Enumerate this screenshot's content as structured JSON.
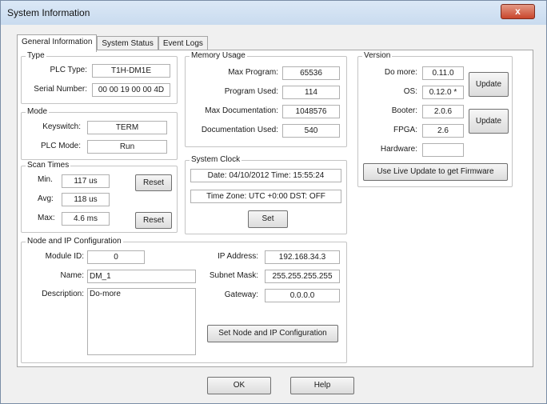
{
  "window": {
    "title": "System Information",
    "close_glyph": "x"
  },
  "tabs": [
    {
      "label": "General Information",
      "active": true
    },
    {
      "label": "System Status",
      "active": false
    },
    {
      "label": "Event Logs",
      "active": false
    }
  ],
  "type_group": {
    "title": "Type",
    "plc_type_label": "PLC Type:",
    "plc_type_value": "T1H-DM1E",
    "serial_label": "Serial Number:",
    "serial_value": "00 00 19 00 00 4D"
  },
  "mode_group": {
    "title": "Mode",
    "keyswitch_label": "Keyswitch:",
    "keyswitch_value": "TERM",
    "plc_mode_label": "PLC Mode:",
    "plc_mode_value": "Run"
  },
  "scan_group": {
    "title": "Scan Times",
    "min_label": "Min.",
    "min_value": "117 us",
    "avg_label": "Avg:",
    "avg_value": "118 us",
    "max_label": "Max:",
    "max_value": "4.6 ms",
    "reset_label": "Reset"
  },
  "memory_group": {
    "title": "Memory Usage",
    "max_program_label": "Max Program:",
    "max_program_value": "65536",
    "program_used_label": "Program Used:",
    "program_used_value": "114",
    "max_doc_label": "Max Documentation:",
    "max_doc_value": "1048576",
    "doc_used_label": "Documentation Used:",
    "doc_used_value": "540"
  },
  "clock_group": {
    "title": "System Clock",
    "date_time": "Date: 04/10/2012  Time: 15:55:24",
    "timezone": "Time Zone: UTC +0:00  DST: OFF",
    "set_label": "Set"
  },
  "version_group": {
    "title": "Version",
    "domore_label": "Do more:",
    "domore_value": "0.11.0",
    "os_label": "OS:",
    "os_value": "0.12.0 *",
    "booter_label": "Booter:",
    "booter_value": "2.0.6",
    "fpga_label": "FPGA:",
    "fpga_value": "2.6",
    "hardware_label": "Hardware:",
    "hardware_value": "",
    "update_label": "Update",
    "live_update_label": "Use Live Update to get Firmware"
  },
  "node_group": {
    "title": "Node and IP Configuration",
    "module_id_label": "Module ID:",
    "module_id_value": "0",
    "name_label": "Name:",
    "name_value": "DM_1",
    "description_label": "Description:",
    "description_value": "Do-more",
    "ip_label": "IP Address:",
    "ip_value": "192.168.34.3",
    "subnet_label": "Subnet Mask:",
    "subnet_value": "255.255.255.255",
    "gateway_label": "Gateway:",
    "gateway_value": "0.0.0.0",
    "set_config_label": "Set Node and IP Configuration"
  },
  "footer": {
    "ok_label": "OK",
    "help_label": "Help"
  }
}
